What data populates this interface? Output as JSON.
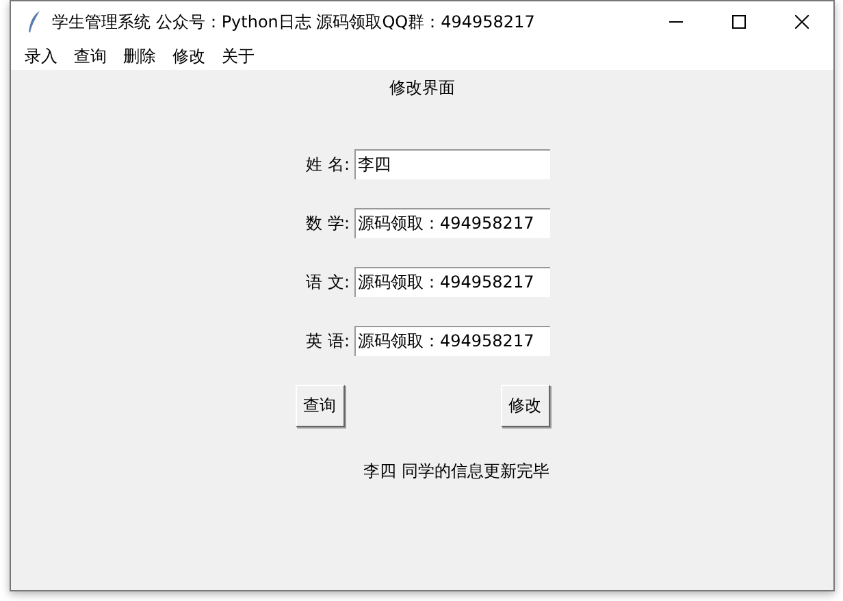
{
  "window": {
    "title": "学生管理系统 公众号：Python日志 源码领取QQ群：494958217"
  },
  "menu": [
    "录入",
    "查询",
    "删除",
    "修改",
    "关于"
  ],
  "heading": "修改界面",
  "fields": [
    {
      "label": "姓 名:",
      "value": "李四"
    },
    {
      "label": "数 学:",
      "value": "源码领取：494958217"
    },
    {
      "label": "语 文:",
      "value": "源码领取：494958217"
    },
    {
      "label": "英 语:",
      "value": "源码领取：494958217"
    }
  ],
  "buttons": [
    "查询",
    "修改"
  ],
  "message": "李四 同学的信息更新完毕"
}
